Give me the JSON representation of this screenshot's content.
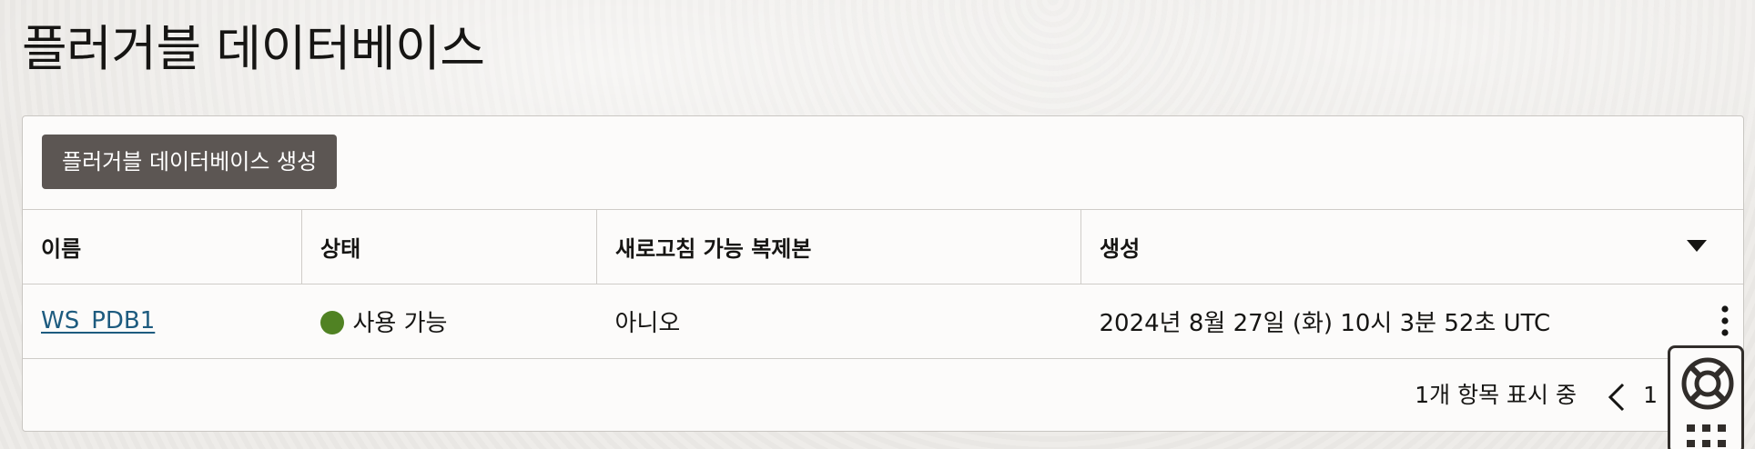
{
  "page": {
    "title": "플러거블 데이터베이스"
  },
  "toolbar": {
    "create_label": "플러거블 데이터베이스 생성"
  },
  "table": {
    "columns": [
      "이름",
      "상태",
      "새로고침 가능 복제본",
      "생성"
    ],
    "sort_icon": "caret-down-icon",
    "rows": [
      {
        "name": "WS_PDB1",
        "status": "사용 가능",
        "status_color": "#508223",
        "refreshable_clone": "아니오",
        "created": "2024년 8월 27일 (화) 10시 3분 52초 UTC",
        "actions_icon": "kebab-menu-icon"
      }
    ]
  },
  "pagination": {
    "count_text": "1개 항목 표시 중",
    "page": "1",
    "prev_icon": "chevron-left-icon"
  },
  "help_widget": {
    "icons": [
      "lifebuoy-icon",
      "app-grid-icon"
    ]
  },
  "colors": {
    "link": "#1d5b7f",
    "button_bg": "#5c5653",
    "status_available": "#508223"
  }
}
